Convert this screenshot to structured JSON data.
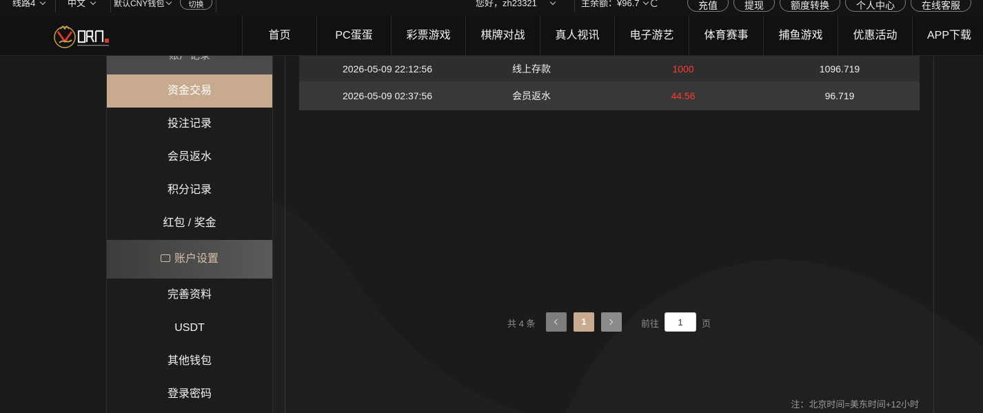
{
  "topbar": {
    "line": "线路4",
    "language": "中文",
    "wallet": "默认CNY钱包",
    "switch_label": "切换",
    "greeting": "您好，zh23321",
    "balance": "主余额：¥96.7",
    "buttons": [
      "充值",
      "提现",
      "额度转换",
      "个人中心",
      "在线客服"
    ]
  },
  "nav": {
    "items": [
      "首页",
      "PC蛋蛋",
      "彩票游戏",
      "棋牌对战",
      "真人视讯",
      "电子游艺",
      "体育赛事",
      "捕鱼游戏",
      "优惠活动",
      "APP下载"
    ]
  },
  "sidebar": {
    "section_records": "账户记录",
    "items_records": [
      "资金交易",
      "投注记录",
      "会员返水",
      "积分记录",
      "红包 / 奖金"
    ],
    "section_settings": "账户设置",
    "items_settings": [
      "完善资料",
      "USDT",
      "其他钱包",
      "登录密码"
    ]
  },
  "table": {
    "rows": [
      {
        "time": "2026-05-09 22:12:56",
        "type": "线上存款",
        "amount": "1000",
        "balance": "1096.719"
      },
      {
        "time": "2026-05-09 02:37:56",
        "type": "会员返水",
        "amount": "44.56",
        "balance": "96.719"
      }
    ]
  },
  "pager": {
    "total": "共 4 条",
    "current_page": "1",
    "goto_label": "前往",
    "goto_value": "1",
    "page_unit": "页"
  },
  "note": "注：北京时间=美东时间+12小时",
  "colors": {
    "accent": "#c8ab8f",
    "amount": "#ff3b30",
    "background": "#1b1b1b"
  }
}
